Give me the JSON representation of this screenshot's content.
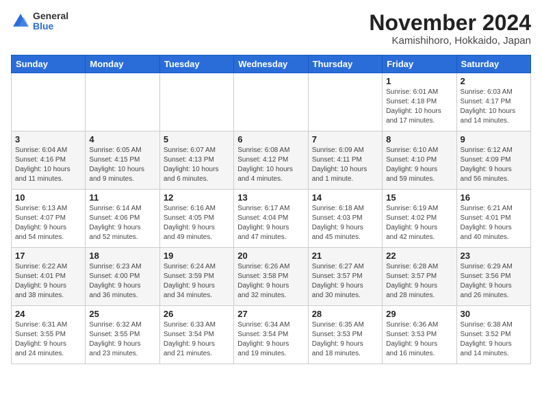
{
  "logo": {
    "general": "General",
    "blue": "Blue"
  },
  "title": {
    "month": "November 2024",
    "location": "Kamishihoro, Hokkaido, Japan"
  },
  "headers": [
    "Sunday",
    "Monday",
    "Tuesday",
    "Wednesday",
    "Thursday",
    "Friday",
    "Saturday"
  ],
  "weeks": [
    [
      {
        "day": "",
        "info": ""
      },
      {
        "day": "",
        "info": ""
      },
      {
        "day": "",
        "info": ""
      },
      {
        "day": "",
        "info": ""
      },
      {
        "day": "",
        "info": ""
      },
      {
        "day": "1",
        "info": "Sunrise: 6:01 AM\nSunset: 4:18 PM\nDaylight: 10 hours\nand 17 minutes."
      },
      {
        "day": "2",
        "info": "Sunrise: 6:03 AM\nSunset: 4:17 PM\nDaylight: 10 hours\nand 14 minutes."
      }
    ],
    [
      {
        "day": "3",
        "info": "Sunrise: 6:04 AM\nSunset: 4:16 PM\nDaylight: 10 hours\nand 11 minutes."
      },
      {
        "day": "4",
        "info": "Sunrise: 6:05 AM\nSunset: 4:15 PM\nDaylight: 10 hours\nand 9 minutes."
      },
      {
        "day": "5",
        "info": "Sunrise: 6:07 AM\nSunset: 4:13 PM\nDaylight: 10 hours\nand 6 minutes."
      },
      {
        "day": "6",
        "info": "Sunrise: 6:08 AM\nSunset: 4:12 PM\nDaylight: 10 hours\nand 4 minutes."
      },
      {
        "day": "7",
        "info": "Sunrise: 6:09 AM\nSunset: 4:11 PM\nDaylight: 10 hours\nand 1 minute."
      },
      {
        "day": "8",
        "info": "Sunrise: 6:10 AM\nSunset: 4:10 PM\nDaylight: 9 hours\nand 59 minutes."
      },
      {
        "day": "9",
        "info": "Sunrise: 6:12 AM\nSunset: 4:09 PM\nDaylight: 9 hours\nand 56 minutes."
      }
    ],
    [
      {
        "day": "10",
        "info": "Sunrise: 6:13 AM\nSunset: 4:07 PM\nDaylight: 9 hours\nand 54 minutes."
      },
      {
        "day": "11",
        "info": "Sunrise: 6:14 AM\nSunset: 4:06 PM\nDaylight: 9 hours\nand 52 minutes."
      },
      {
        "day": "12",
        "info": "Sunrise: 6:16 AM\nSunset: 4:05 PM\nDaylight: 9 hours\nand 49 minutes."
      },
      {
        "day": "13",
        "info": "Sunrise: 6:17 AM\nSunset: 4:04 PM\nDaylight: 9 hours\nand 47 minutes."
      },
      {
        "day": "14",
        "info": "Sunrise: 6:18 AM\nSunset: 4:03 PM\nDaylight: 9 hours\nand 45 minutes."
      },
      {
        "day": "15",
        "info": "Sunrise: 6:19 AM\nSunset: 4:02 PM\nDaylight: 9 hours\nand 42 minutes."
      },
      {
        "day": "16",
        "info": "Sunrise: 6:21 AM\nSunset: 4:01 PM\nDaylight: 9 hours\nand 40 minutes."
      }
    ],
    [
      {
        "day": "17",
        "info": "Sunrise: 6:22 AM\nSunset: 4:01 PM\nDaylight: 9 hours\nand 38 minutes."
      },
      {
        "day": "18",
        "info": "Sunrise: 6:23 AM\nSunset: 4:00 PM\nDaylight: 9 hours\nand 36 minutes."
      },
      {
        "day": "19",
        "info": "Sunrise: 6:24 AM\nSunset: 3:59 PM\nDaylight: 9 hours\nand 34 minutes."
      },
      {
        "day": "20",
        "info": "Sunrise: 6:26 AM\nSunset: 3:58 PM\nDaylight: 9 hours\nand 32 minutes."
      },
      {
        "day": "21",
        "info": "Sunrise: 6:27 AM\nSunset: 3:57 PM\nDaylight: 9 hours\nand 30 minutes."
      },
      {
        "day": "22",
        "info": "Sunrise: 6:28 AM\nSunset: 3:57 PM\nDaylight: 9 hours\nand 28 minutes."
      },
      {
        "day": "23",
        "info": "Sunrise: 6:29 AM\nSunset: 3:56 PM\nDaylight: 9 hours\nand 26 minutes."
      }
    ],
    [
      {
        "day": "24",
        "info": "Sunrise: 6:31 AM\nSunset: 3:55 PM\nDaylight: 9 hours\nand 24 minutes."
      },
      {
        "day": "25",
        "info": "Sunrise: 6:32 AM\nSunset: 3:55 PM\nDaylight: 9 hours\nand 23 minutes."
      },
      {
        "day": "26",
        "info": "Sunrise: 6:33 AM\nSunset: 3:54 PM\nDaylight: 9 hours\nand 21 minutes."
      },
      {
        "day": "27",
        "info": "Sunrise: 6:34 AM\nSunset: 3:54 PM\nDaylight: 9 hours\nand 19 minutes."
      },
      {
        "day": "28",
        "info": "Sunrise: 6:35 AM\nSunset: 3:53 PM\nDaylight: 9 hours\nand 18 minutes."
      },
      {
        "day": "29",
        "info": "Sunrise: 6:36 AM\nSunset: 3:53 PM\nDaylight: 9 hours\nand 16 minutes."
      },
      {
        "day": "30",
        "info": "Sunrise: 6:38 AM\nSunset: 3:52 PM\nDaylight: 9 hours\nand 14 minutes."
      }
    ]
  ]
}
